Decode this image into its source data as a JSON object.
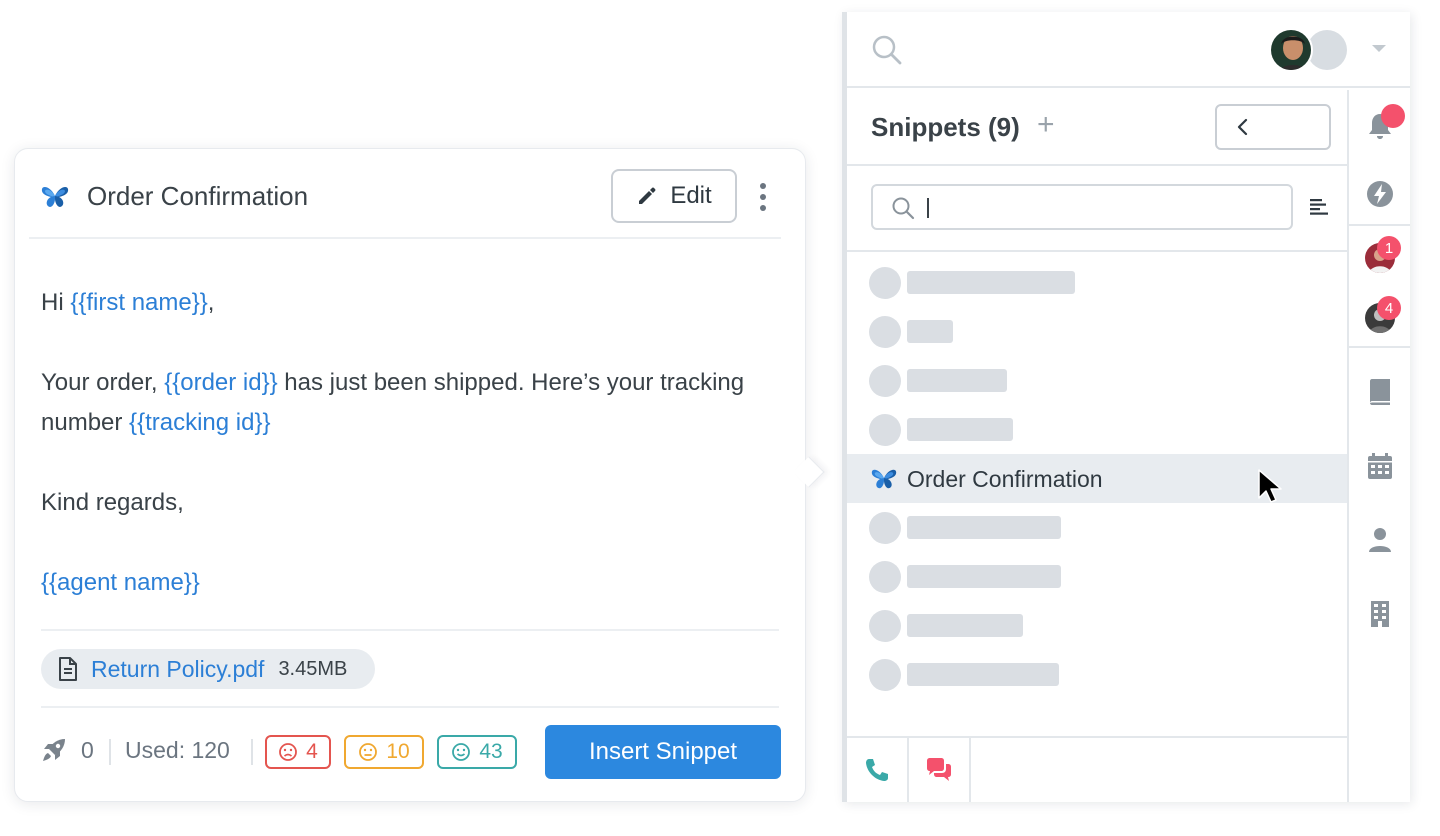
{
  "snippet_card": {
    "title": "Order Confirmation",
    "edit_label": "Edit",
    "body": {
      "greeting_prefix": "Hi ",
      "greeting_var": "{{first name}}",
      "greeting_suffix": ",",
      "line1_prefix": "Your order, ",
      "line1_var": "{{order id}}",
      "line1_mid": " has just been shipped. Here’s your tracking number ",
      "line1_var2": "{{tracking id}}",
      "closing": "Kind regards,",
      "signature_var": "{{agent name}}"
    },
    "attachment": {
      "name": "Return Policy.pdf",
      "size": "3.45MB"
    },
    "footer": {
      "rocket_count": "0",
      "used_label": "Used: 120",
      "sad_count": "4",
      "neutral_count": "10",
      "happy_count": "43",
      "insert_label": "Insert Snippet"
    }
  },
  "app_panel": {
    "snippets_title": "Snippets (9)",
    "add_label": "+",
    "search": {
      "placeholder": "",
      "value": ""
    },
    "active_item": {
      "label": "Order Confirmation"
    },
    "rail": {
      "badge_1": "1",
      "badge_2": "4"
    }
  },
  "colors": {
    "accent": "#2c88df",
    "variable": "#2c7fd6",
    "sad": "#e4554f",
    "neutral": "#f0a830",
    "happy": "#3aa9a8",
    "notification": "#f4516c"
  },
  "icons": [
    "butterfly-logo-icon",
    "pencil-icon",
    "kebab-menu-icon",
    "file-icon",
    "rocket-icon",
    "sad-face-icon",
    "neutral-face-icon",
    "happy-face-icon",
    "search-icon",
    "chevron-down-icon",
    "chevron-left-icon",
    "sort-icon",
    "mouse-pointer-icon",
    "phone-icon",
    "chat-icon",
    "bell-icon",
    "bolt-icon",
    "book-icon",
    "calendar-icon",
    "person-icon",
    "building-icon"
  ]
}
